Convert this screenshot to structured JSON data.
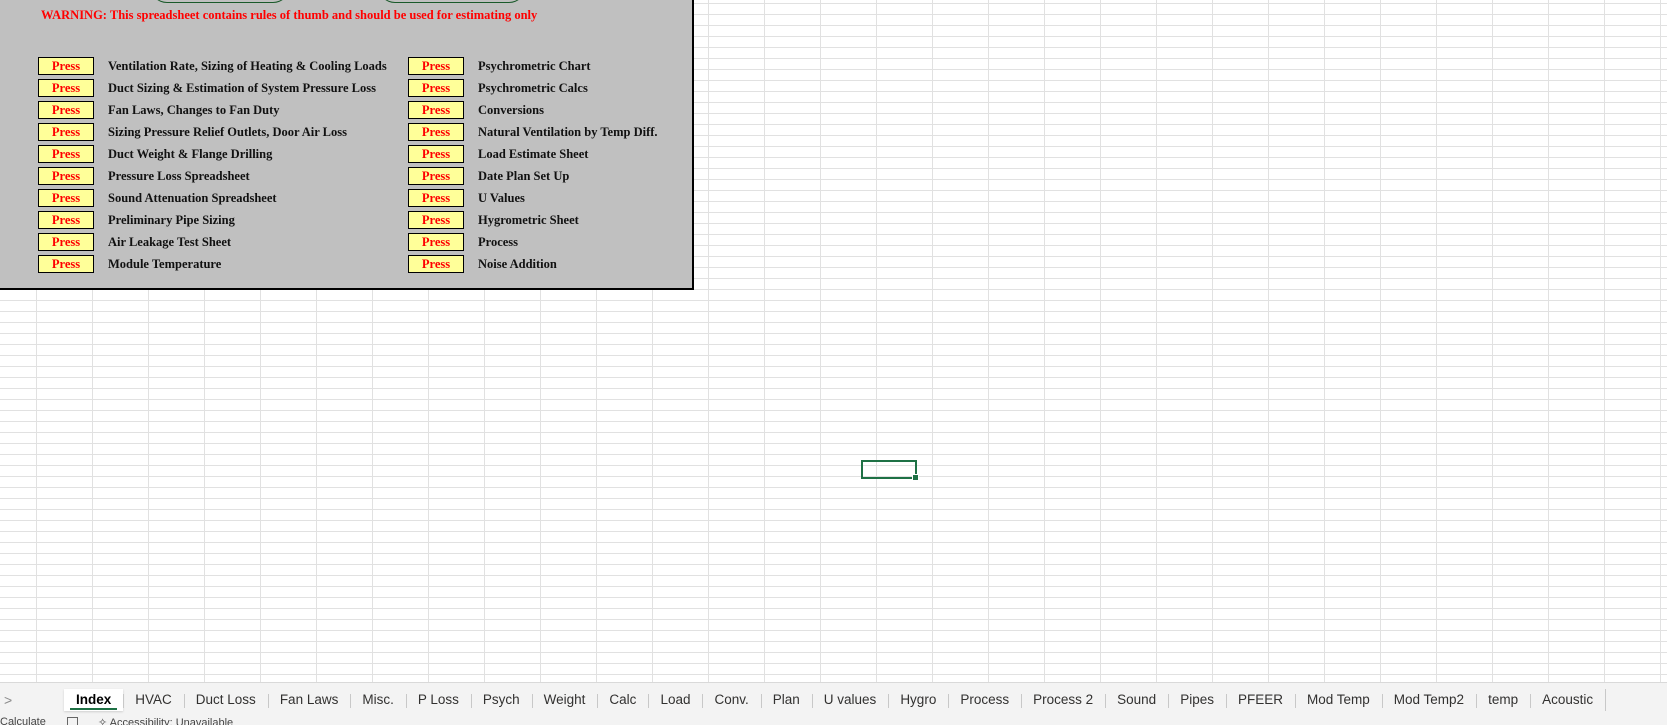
{
  "panel": {
    "warning": "WARNING: This spreadsheet contains rules of thumb and should be used for estimating only",
    "press_label": "Press",
    "left_items": [
      "Ventilation Rate, Sizing of Heating & Cooling Loads",
      "Duct Sizing & Estimation of System Pressure Loss",
      "Fan Laws, Changes to Fan Duty",
      "Sizing Pressure Relief Outlets, Door Air Loss",
      "Duct Weight & Flange Drilling",
      "Pressure Loss Spreadsheet",
      "Sound Attenuation Spreadsheet",
      "Preliminary Pipe Sizing",
      "Air Leakage Test Sheet",
      "Module Temperature"
    ],
    "right_items": [
      "Psychrometric Chart",
      "Psychrometric Calcs",
      "Conversions",
      "Natural Ventilation by Temp Diff.",
      "Load Estimate Sheet",
      "Date Plan Set Up",
      "U Values",
      "Hygrometric Sheet",
      "Process",
      "Noise Addition"
    ]
  },
  "tabs": {
    "nav_icon": ">",
    "items": [
      "Index",
      "HVAC",
      "Duct Loss",
      "Fan Laws",
      "Misc.",
      "P Loss",
      "Psych",
      "Weight",
      "Calc",
      "Load",
      "Conv.",
      "Plan",
      "U values",
      "Hygro",
      "Process",
      "Process 2",
      "Sound",
      "Pipes",
      "PFEER",
      "Mod Temp",
      "Mod Temp2",
      "temp",
      "Acoustic"
    ],
    "active": "Index"
  },
  "status": {
    "mode": "Calculate",
    "accessibility": "Accessibility: Unavailable"
  },
  "colors": {
    "panel_bg": "#c0c0c0",
    "press_bg": "#ffff99",
    "press_text": "#ff0000",
    "warning_text": "#ff0000",
    "accent": "#1e7145"
  }
}
